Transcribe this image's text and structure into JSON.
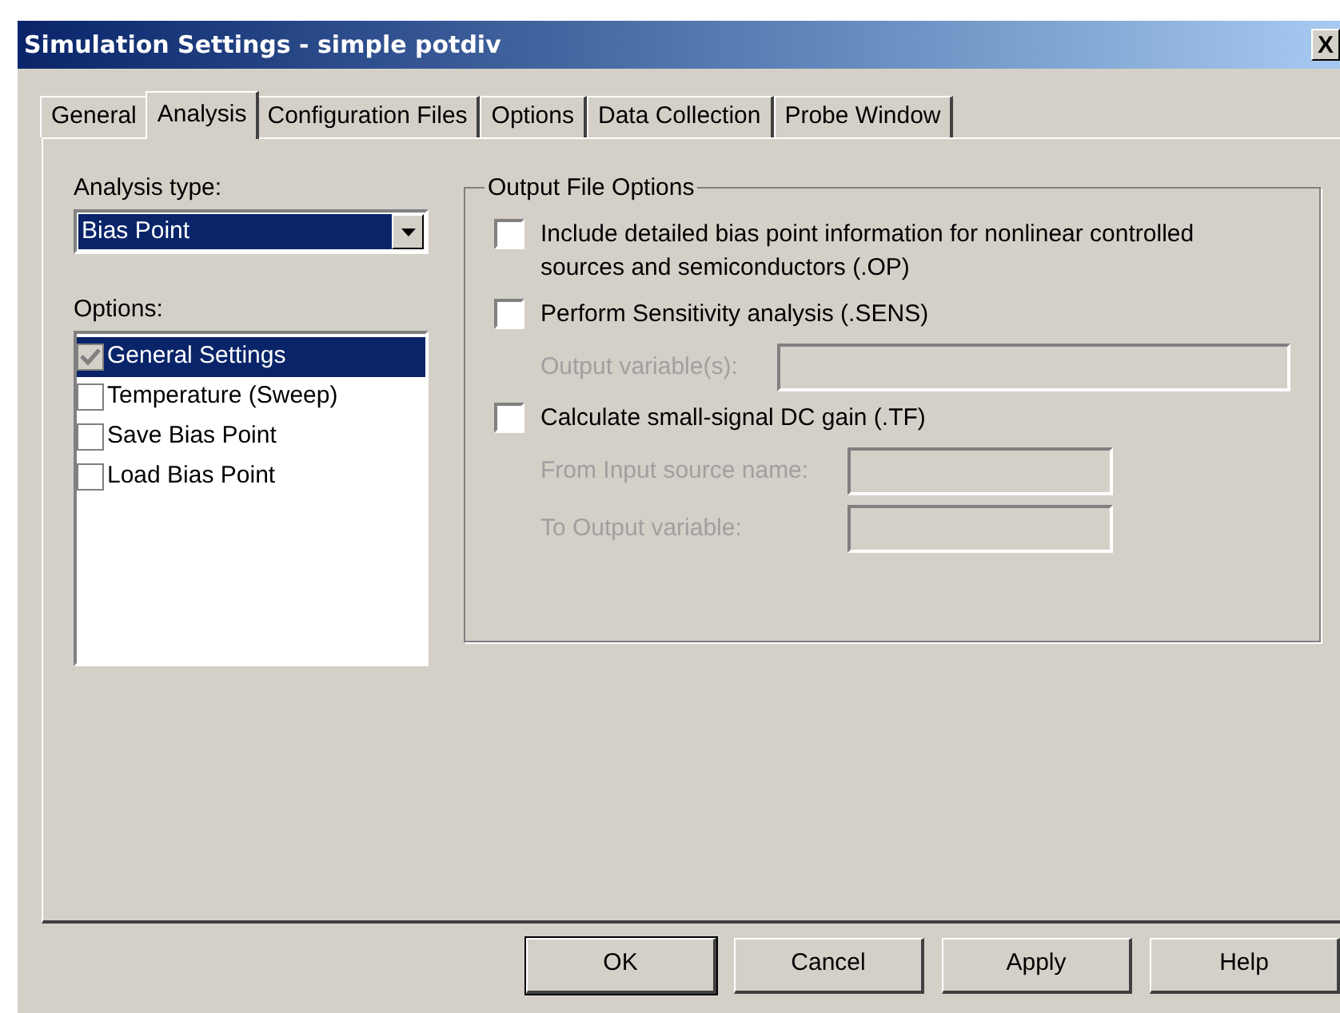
{
  "window": {
    "title": "Simulation Settings - simple potdiv",
    "close": "X"
  },
  "tabs": [
    {
      "label": "General",
      "selected": false
    },
    {
      "label": "Analysis",
      "selected": true
    },
    {
      "label": "Configuration Files",
      "selected": false
    },
    {
      "label": "Options",
      "selected": false
    },
    {
      "label": "Data Collection",
      "selected": false
    },
    {
      "label": "Probe Window",
      "selected": false
    }
  ],
  "analysis_type": {
    "label": "Analysis type:",
    "value": "Bias Point"
  },
  "options": {
    "label": "Options:",
    "items": [
      {
        "label": "General Settings",
        "checked": true,
        "selected": true
      },
      {
        "label": "Temperature (Sweep)",
        "checked": false,
        "selected": false
      },
      {
        "label": "Save Bias Point",
        "checked": false,
        "selected": false
      },
      {
        "label": "Load Bias Point",
        "checked": false,
        "selected": false
      }
    ]
  },
  "output_file_options": {
    "title": "Output File Options",
    "items": [
      {
        "label": "Include detailed bias point information for nonlinear controlled sources and semiconductors (.OP)",
        "checked": false
      },
      {
        "label": "Perform Sensitivity analysis (.SENS)",
        "checked": false,
        "fields": [
          {
            "label": "Output variable(s):",
            "disabled": true
          }
        ]
      },
      {
        "label": "Calculate small-signal DC gain (.TF)",
        "checked": false,
        "fields": [
          {
            "label": "From Input source name:",
            "disabled": true
          },
          {
            "label": "To Output variable:",
            "disabled": true
          }
        ]
      }
    ]
  },
  "buttons": [
    {
      "label": "OK",
      "default": true
    },
    {
      "label": "Cancel",
      "default": false
    },
    {
      "label": "Apply",
      "default": false
    },
    {
      "label": "Help",
      "default": false
    }
  ]
}
